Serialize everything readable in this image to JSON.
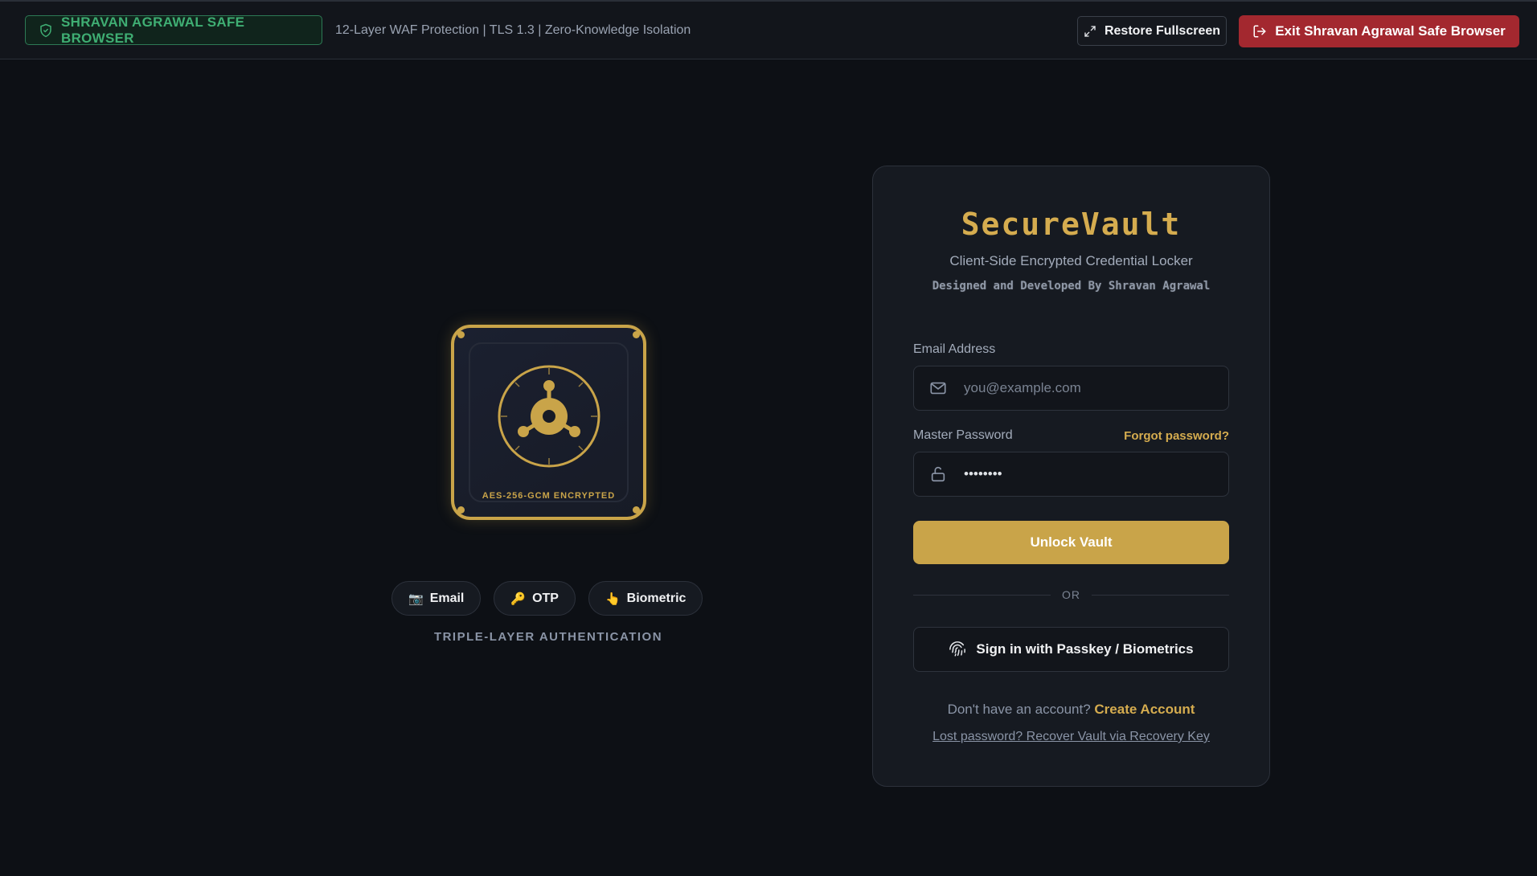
{
  "topbar": {
    "brand": "SHRAVAN AGRAWAL SAFE BROWSER",
    "subtitle": "12-Layer WAF Protection | TLS 1.3 | Zero-Knowledge Isolation",
    "restore_label": "Restore Fullscreen",
    "exit_label": "Exit Shravan Agrawal Safe Browser"
  },
  "hero": {
    "vault_label": "AES-256-GCM ENCRYPTED",
    "pills": [
      {
        "icon": "📷",
        "label": "Email"
      },
      {
        "icon": "🔑",
        "label": "OTP"
      },
      {
        "icon": "👆",
        "label": "Biometric"
      }
    ],
    "caption": "TRIPLE-LAYER AUTHENTICATION"
  },
  "card": {
    "title": "SecureVault",
    "subtitle": "Client-Side Encrypted Credential Locker",
    "credit": "Designed and Developed By Shravan Agrawal",
    "email_label": "Email Address",
    "email_placeholder": "you@example.com",
    "email_value": "",
    "password_label": "Master Password",
    "password_value": "••••••••",
    "forgot_label": "Forgot password?",
    "unlock_label": "Unlock Vault",
    "divider_label": "OR",
    "passkey_label": "Sign in with Passkey / Biometrics",
    "signup_prompt": "Don't have an account?",
    "signup_link": "Create Account",
    "recover_link": "Lost password? Recover Vault via Recovery Key"
  },
  "colors": {
    "accent": "#c9a449",
    "exit": "#a3282f",
    "brand_green": "#3fae73",
    "background": "#0d1015"
  }
}
